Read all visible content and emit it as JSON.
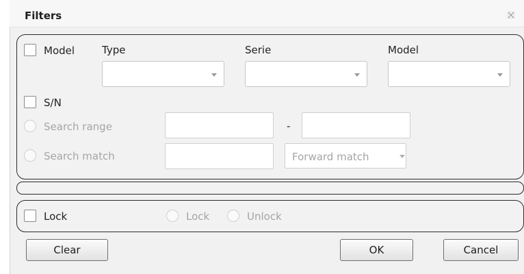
{
  "dialog": {
    "title": "Filters",
    "close_icon": "close-icon"
  },
  "model_filter": {
    "checkbox_label": "Model",
    "checked": false,
    "type_label": "Type",
    "type_value": "",
    "serie_label": "Serie",
    "serie_value": "",
    "model_label": "Model",
    "model_value": ""
  },
  "sn_filter": {
    "checkbox_label": "S/N",
    "checked": false,
    "search_range_label": "Search range",
    "range_from_value": "",
    "range_separator": "-",
    "range_to_value": "",
    "search_match_label": "Search match",
    "match_value": "",
    "match_mode": "Forward match"
  },
  "lock_filter": {
    "checkbox_label": "Lock",
    "checked": false,
    "lock_option": "Lock",
    "unlock_option": "Unlock"
  },
  "buttons": {
    "clear": "Clear",
    "ok": "OK",
    "cancel": "Cancel"
  },
  "colors": {
    "group_border": "#2b2b2b",
    "disabled_text": "#a5a5a5",
    "background": "#f1f1f1"
  }
}
